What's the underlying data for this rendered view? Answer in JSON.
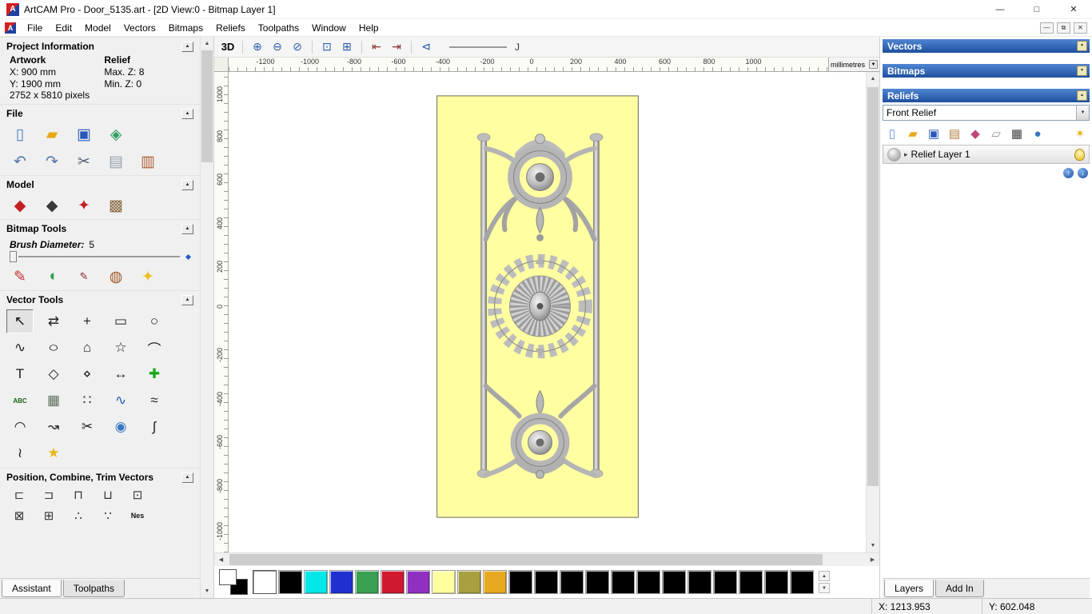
{
  "window": {
    "title": "ArtCAM Pro - Door_5135.art - [2D View:0 - Bitmap Layer 1]",
    "minimize": "—",
    "maximize": "□",
    "close": "✕"
  },
  "menu": {
    "items": [
      "File",
      "Edit",
      "Model",
      "Vectors",
      "Bitmaps",
      "Reliefs",
      "Toolpaths",
      "Window",
      "Help"
    ],
    "mdi": [
      "—",
      "⧉",
      "✕"
    ]
  },
  "ui": {
    "collapse_up": "▲",
    "dropdown_down": "▼",
    "caret_right": "▸",
    "scroll_up": "▲",
    "scroll_down": "▼",
    "scroll_left": "◀",
    "scroll_right": "▶",
    "arrow_up": "↑",
    "arrow_down": "↓"
  },
  "canvas_toolbar": {
    "buttons": [
      {
        "name": "view-3d-button",
        "glyph": "3D",
        "color": "#000000",
        "bold": true
      },
      {
        "name": "zoom-in-icon",
        "glyph": "⊕",
        "color": "#2a5ca8"
      },
      {
        "name": "zoom-out-icon",
        "glyph": "⊖",
        "color": "#2a5ca8"
      },
      {
        "name": "zoom-scale-icon",
        "glyph": "⊘",
        "color": "#2a5ca8"
      },
      {
        "name": "zoom-box-icon",
        "glyph": "⊡",
        "color": "#2a5ca8"
      },
      {
        "name": "zoom-fit-icon",
        "glyph": "⊞",
        "color": "#2a5ca8"
      },
      {
        "name": "previous-view-icon",
        "glyph": "⇤",
        "color": "#8a3030"
      },
      {
        "name": "next-view-icon",
        "glyph": "⇥",
        "color": "#8a3030"
      },
      {
        "name": "zoom-previous-icon",
        "glyph": "⊲",
        "color": "#2a5ca8"
      }
    ],
    "line_preview_label": "J"
  },
  "rulers": {
    "unit": "millimetres",
    "horizontal": [
      "-1200",
      "-1000",
      "-800",
      "-600",
      "-400",
      "-200",
      "0",
      "200",
      "400",
      "600",
      "800",
      "1000"
    ],
    "vertical": [
      "1000",
      "800",
      "600",
      "400",
      "200",
      "0",
      "-200",
      "-400",
      "-600",
      "-800",
      "-1000"
    ]
  },
  "assistant": {
    "tabs": [
      {
        "label": "Assistant",
        "active": true
      },
      {
        "label": "Toolpaths",
        "active": false
      }
    ],
    "project_information": {
      "title": "Project Information",
      "artwork_label": "Artwork",
      "relief_label": "Relief",
      "x": "X: 900 mm",
      "y": "Y: 1900 mm",
      "max_z": "Max. Z: 8",
      "min_z": "Min. Z: 0",
      "pixels": "2752 x 5810 pixels"
    },
    "file": {
      "title": "File",
      "row1": [
        {
          "name": "new-model-icon",
          "glyph": "▯",
          "color": "#4a7ec8"
        },
        {
          "name": "open-model-icon",
          "glyph": "▰",
          "color": "#e8a818"
        },
        {
          "name": "save-model-icon",
          "glyph": "▣",
          "color": "#2858b8"
        },
        {
          "name": "import-model-icon",
          "glyph": "◈",
          "color": "#30a060"
        }
      ],
      "row2": [
        {
          "name": "undo-icon",
          "glyph": "↶",
          "color": "#5a78a8"
        },
        {
          "name": "redo-icon",
          "glyph": "↷",
          "color": "#5a78a8"
        },
        {
          "name": "cut-icon",
          "glyph": "✂",
          "color": "#506070"
        },
        {
          "name": "paste-icon",
          "glyph": "▤",
          "color": "#98a0a8"
        },
        {
          "name": "notes-icon",
          "glyph": "▥",
          "color": "#b06038"
        }
      ]
    },
    "model": {
      "title": "Model",
      "icons": [
        {
          "name": "set-model-size-icon",
          "glyph": "◆",
          "color": "#c02020"
        },
        {
          "name": "adjust-model-icon",
          "glyph": "◆",
          "color": "#383838"
        },
        {
          "name": "mirror-relief-icon",
          "glyph": "✦",
          "color": "#c02020"
        },
        {
          "name": "load-image-icon",
          "glyph": "▩",
          "color": "#8a6a40"
        }
      ]
    },
    "bitmap_tools": {
      "title": "Bitmap Tools",
      "brush_label": "Brush Diameter:",
      "brush_value": "5",
      "icons": [
        {
          "name": "paint-brush-icon",
          "glyph": "✎",
          "color": "#c03030"
        },
        {
          "name": "paint-selected-colour-icon",
          "glyph": "◖",
          "color": "#30a050"
        },
        {
          "name": "draw-icon",
          "glyph": "✎",
          "color": "#883030",
          "small": true
        },
        {
          "name": "colour-palette-icon",
          "glyph": "◍",
          "color": "#a05828"
        },
        {
          "name": "flood-fill-icon",
          "glyph": "✦",
          "color": "#e8c020"
        }
      ]
    },
    "vector_tools": {
      "title": "Vector Tools",
      "tools": [
        {
          "name": "select-vectors-icon",
          "glyph": "↖",
          "color": "#101010",
          "pressed": true
        },
        {
          "name": "transform-vectors-icon",
          "glyph": "⇄",
          "color": "#222222"
        },
        {
          "name": "node-editing-icon",
          "glyph": "+",
          "color": "#222222"
        },
        {
          "name": "create-rectangle-icon",
          "glyph": "▭",
          "color": "#222222"
        },
        {
          "name": "create-circle-icon",
          "glyph": "○",
          "color": "#222222"
        },
        {
          "name": "create-polyline-icon",
          "glyph": "∿",
          "color": "#222222"
        },
        {
          "name": "create-ellipse-icon",
          "glyph": "○",
          "color": "#222222",
          "wide": true
        },
        {
          "name": "create-polygon-icon",
          "glyph": "⌂",
          "color": "#222222"
        },
        {
          "name": "create-star-icon",
          "glyph": "☆",
          "color": "#222222"
        },
        {
          "name": "create-arc-icon",
          "glyph": "⌒",
          "color": "#222222"
        },
        {
          "name": "create-text-icon",
          "glyph": "T",
          "color": "#202020"
        },
        {
          "name": "offset-vectors-icon",
          "glyph": "◇",
          "color": "#222222"
        },
        {
          "name": "offset-copy-icon",
          "glyph": "⋄",
          "color": "#222222"
        },
        {
          "name": "measure-icon",
          "glyph": "↔",
          "color": "#222222"
        },
        {
          "name": "paste-vector-icon",
          "glyph": "✚",
          "color": "#18a818"
        },
        {
          "name": "text-abc-icon",
          "glyph": "ABC",
          "color": "#186018",
          "small": true
        },
        {
          "name": "wrap-text-icon",
          "glyph": "▦",
          "color": "#607060"
        },
        {
          "name": "block-copy-icon",
          "glyph": "∷",
          "color": "#222222"
        },
        {
          "name": "fit-curve-icon",
          "glyph": "∿",
          "color": "#2858b8"
        },
        {
          "name": "smooth-curve-icon",
          "glyph": "≈",
          "color": "#222222"
        },
        {
          "name": "arc-tool-icon",
          "glyph": "◠",
          "color": "#222222"
        },
        {
          "name": "join-vectors-icon",
          "glyph": "↝",
          "color": "#222222"
        },
        {
          "name": "trim-vectors-icon",
          "glyph": "✂",
          "color": "#202020"
        },
        {
          "name": "extrude-tool-icon",
          "glyph": "◉",
          "color": "#3878c0"
        },
        {
          "name": "spline-tool-icon",
          "glyph": "ʃ",
          "color": "#222222"
        },
        {
          "name": "distort-vectors-icon",
          "glyph": "≀",
          "color": "#222222"
        },
        {
          "name": "wand-tool-icon",
          "glyph": "★",
          "color": "#e8b818"
        }
      ]
    },
    "position_tools": {
      "title": "Position, Combine, Trim Vectors",
      "row1": [
        {
          "name": "align-left-icon",
          "glyph": "⊏",
          "color": "#333333"
        },
        {
          "name": "align-right-icon",
          "glyph": "⊐",
          "color": "#333333"
        },
        {
          "name": "align-top-icon",
          "glyph": "⊓",
          "color": "#333333"
        },
        {
          "name": "align-bottom-icon",
          "glyph": "⊔",
          "color": "#333333"
        },
        {
          "name": "align-centre-icon",
          "glyph": "⊡",
          "color": "#333333"
        }
      ],
      "row2": [
        {
          "name": "group-vectors-icon",
          "glyph": "⊠",
          "color": "#333333"
        },
        {
          "name": "ungroup-vectors-icon",
          "glyph": "⊞",
          "color": "#333333"
        },
        {
          "name": "weld-vectors-icon",
          "glyph": "∴",
          "color": "#333333"
        },
        {
          "name": "trim-overlap-icon",
          "glyph": "∵",
          "color": "#333333"
        },
        {
          "name": "nest-vectors-icon",
          "glyph": "Nes",
          "color": "#111111",
          "small": true
        }
      ]
    }
  },
  "palette": {
    "primary_colour": "#ffffff",
    "secondary_colour": "#000000",
    "selected_index": 0,
    "colors": [
      "#ffffff",
      "#000000",
      "#00e8e8",
      "#2030d0",
      "#38a050",
      "#d01830",
      "#9030c0",
      "#ffffa0",
      "#a8a040",
      "#e8a820",
      "#000000",
      "#000000",
      "#000000",
      "#000000",
      "#000000",
      "#000000",
      "#000000",
      "#000000",
      "#000000",
      "#000000",
      "#000000",
      "#000000"
    ]
  },
  "right_panel": {
    "vectors_header": "Vectors",
    "bitmaps_header": "Bitmaps",
    "reliefs_header": "Reliefs",
    "relief_combo": "Front Relief",
    "relief_tools": [
      {
        "name": "new-relief-layer-icon",
        "glyph": "▯",
        "color": "#5b8fd0"
      },
      {
        "name": "open-relief-icon",
        "glyph": "▰",
        "color": "#e8a818"
      },
      {
        "name": "save-relief-icon",
        "glyph": "▣",
        "color": "#2858b8"
      },
      {
        "name": "duplicate-layer-icon",
        "glyph": "▤",
        "color": "#b08040"
      },
      {
        "name": "gem-tool-icon",
        "glyph": "◆",
        "color": "#c04878"
      },
      {
        "name": "blank-layer-icon",
        "glyph": "▱",
        "color": "#909090"
      },
      {
        "name": "greyscale-view-icon",
        "glyph": "▦",
        "color": "#404040"
      },
      {
        "name": "sphere-preview-icon",
        "glyph": "●",
        "color": "#3878c0"
      },
      {
        "name": "visibility-bulb-icon",
        "glyph": "✶",
        "color": "#e8b818",
        "gap": true
      }
    ],
    "layer": {
      "name": "Relief Layer 1"
    },
    "tabs": [
      {
        "label": "Layers",
        "active": true
      },
      {
        "label": "Add In",
        "active": false
      }
    ]
  },
  "statusbar": {
    "x": "X: 1213.953",
    "y": "Y: 602.048"
  }
}
